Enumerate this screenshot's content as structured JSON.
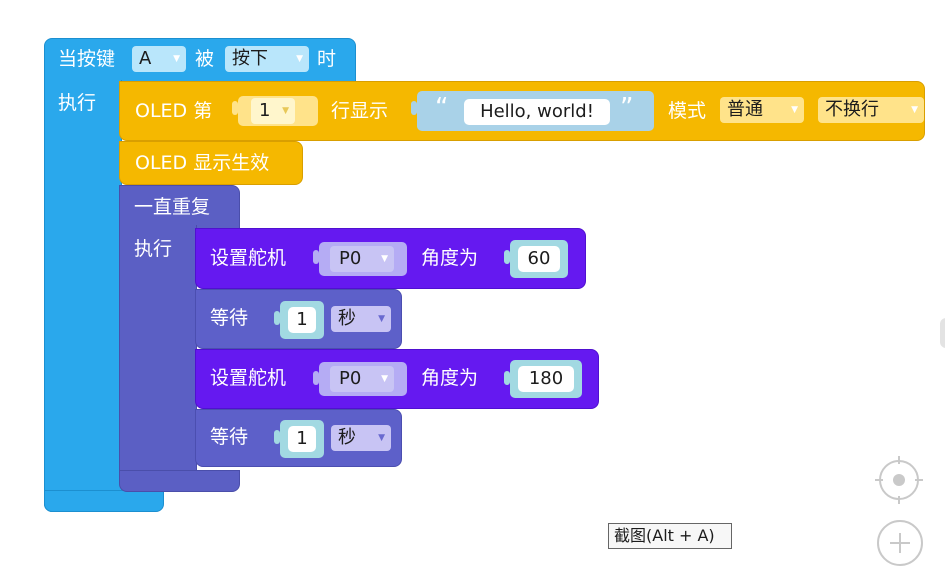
{
  "event_block": {
    "prefix": "当按键",
    "button_value": "A",
    "middle": "被",
    "action_value": "按下",
    "suffix": "时",
    "do_label": "执行"
  },
  "oled_show": {
    "label": "OLED 第",
    "line_value": "1",
    "line_suffix": "行显示",
    "open_quote": "“",
    "text_value": "Hello, world!",
    "close_quote": "”",
    "mode_label": "模式",
    "mode_value": "普通",
    "wrap_value": "不换行"
  },
  "oled_apply": {
    "label": "OLED 显示生效"
  },
  "loop_block": {
    "label": "一直重复",
    "do_label": "执行"
  },
  "statements": [
    {
      "label": "设置舵机",
      "pin_value": "P0",
      "angle_label": "角度为",
      "angle_value": "60"
    },
    {
      "label": "等待",
      "time_value": "1",
      "unit_value": "秒"
    },
    {
      "label": "设置舵机",
      "pin_value": "P0",
      "angle_label": "角度为",
      "angle_value": "180"
    },
    {
      "label": "等待",
      "time_value": "1",
      "unit_value": "秒"
    }
  ],
  "tooltip": {
    "text": "截图(Alt + A)"
  },
  "workspace_controls": [
    "recenter-icon",
    "zoom-in-icon"
  ],
  "colors": {
    "event": "#2aa8ec",
    "oled": "#f5b800",
    "loop": "#5b5fc4",
    "servo": "#6519f0",
    "wait": "#5d60c9"
  }
}
